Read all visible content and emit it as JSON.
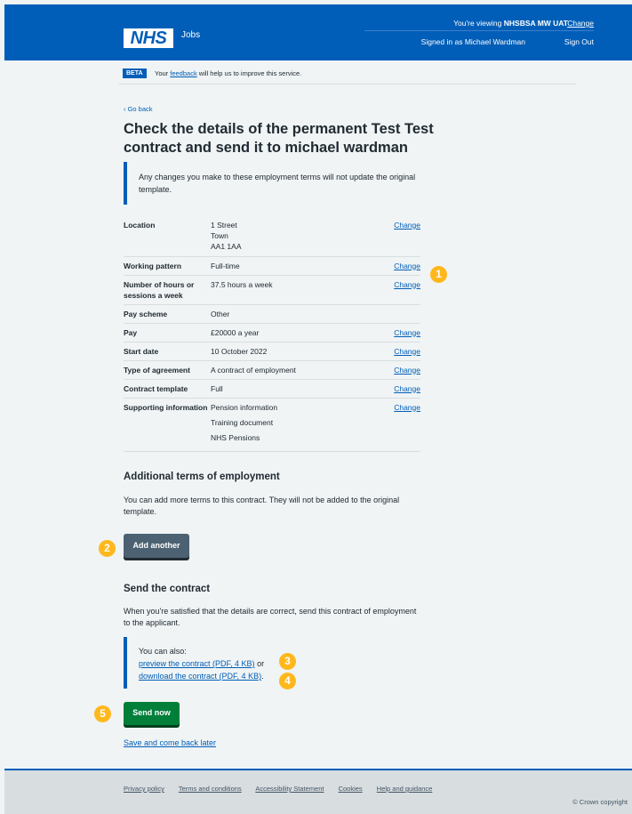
{
  "header": {
    "logo": "NHS",
    "service": "Jobs",
    "viewing_prefix": "You're viewing",
    "viewing_org": "NHSBSA MW UAT",
    "change_link": "Change",
    "signed_in": "Signed in as Michael Wardman",
    "sign_out": "Sign Out"
  },
  "beta": {
    "tag": "BETA",
    "text_before": "Your",
    "feedback_link": "feedback",
    "text_after": "will help us to improve this service."
  },
  "page": {
    "go_back": "Go back",
    "title": "Check the details of the permanent Test Test contract and send it to michael wardman",
    "inset_text": "Any changes you make to these employment terms will not update the original template."
  },
  "summary": [
    {
      "key": "Location",
      "lines": [
        "1 Street",
        "Town",
        "AA1 1AA"
      ],
      "action": "Change"
    },
    {
      "key": "Working pattern",
      "lines": [
        "Full-time"
      ],
      "action": "Change"
    },
    {
      "key": "Number of hours or sessions a week",
      "lines": [
        "37.5 hours a week"
      ],
      "action": "Change"
    },
    {
      "key": "Pay scheme",
      "lines": [
        "Other"
      ],
      "action": ""
    },
    {
      "key": "Pay",
      "lines": [
        "£20000 a year"
      ],
      "action": "Change"
    },
    {
      "key": "Start date",
      "lines": [
        "10 October 2022"
      ],
      "action": "Change"
    },
    {
      "key": "Type of agreement",
      "lines": [
        "A contract of employment"
      ],
      "action": "Change"
    },
    {
      "key": "Contract template",
      "lines": [
        "Full"
      ],
      "action": "Change"
    },
    {
      "key": "Supporting information",
      "lines": [
        "Pension information",
        "Training document",
        "NHS Pensions"
      ],
      "action": "Change"
    }
  ],
  "additional": {
    "heading": "Additional terms of employment",
    "text": "You can add more terms to this contract. They will not be added to the original template.",
    "button": "Add another"
  },
  "send": {
    "heading": "Send the contract",
    "text": "When you're satisfied that the details are correct, send this contract of employment to the applicant.",
    "also": "You can also:",
    "preview_link": "preview the contract (PDF, 4 KB)",
    "or": "or",
    "download_link": "download the contract (PDF, 4 KB)",
    "period": ".",
    "button": "Send now",
    "save_link": "Save and come back later"
  },
  "badges": [
    "1",
    "2",
    "3",
    "4",
    "5"
  ],
  "footer": {
    "links": [
      "Privacy policy",
      "Terms and conditions",
      "Accessibility Statement",
      "Cookies",
      "Help and guidance"
    ],
    "copyright": "© Crown copyright"
  },
  "colors": {
    "nhs_blue": "#005eb8",
    "green": "#007f3b",
    "grey_button": "#4c6272",
    "badge": "#ffb81c",
    "background": "#f0f4f5"
  }
}
